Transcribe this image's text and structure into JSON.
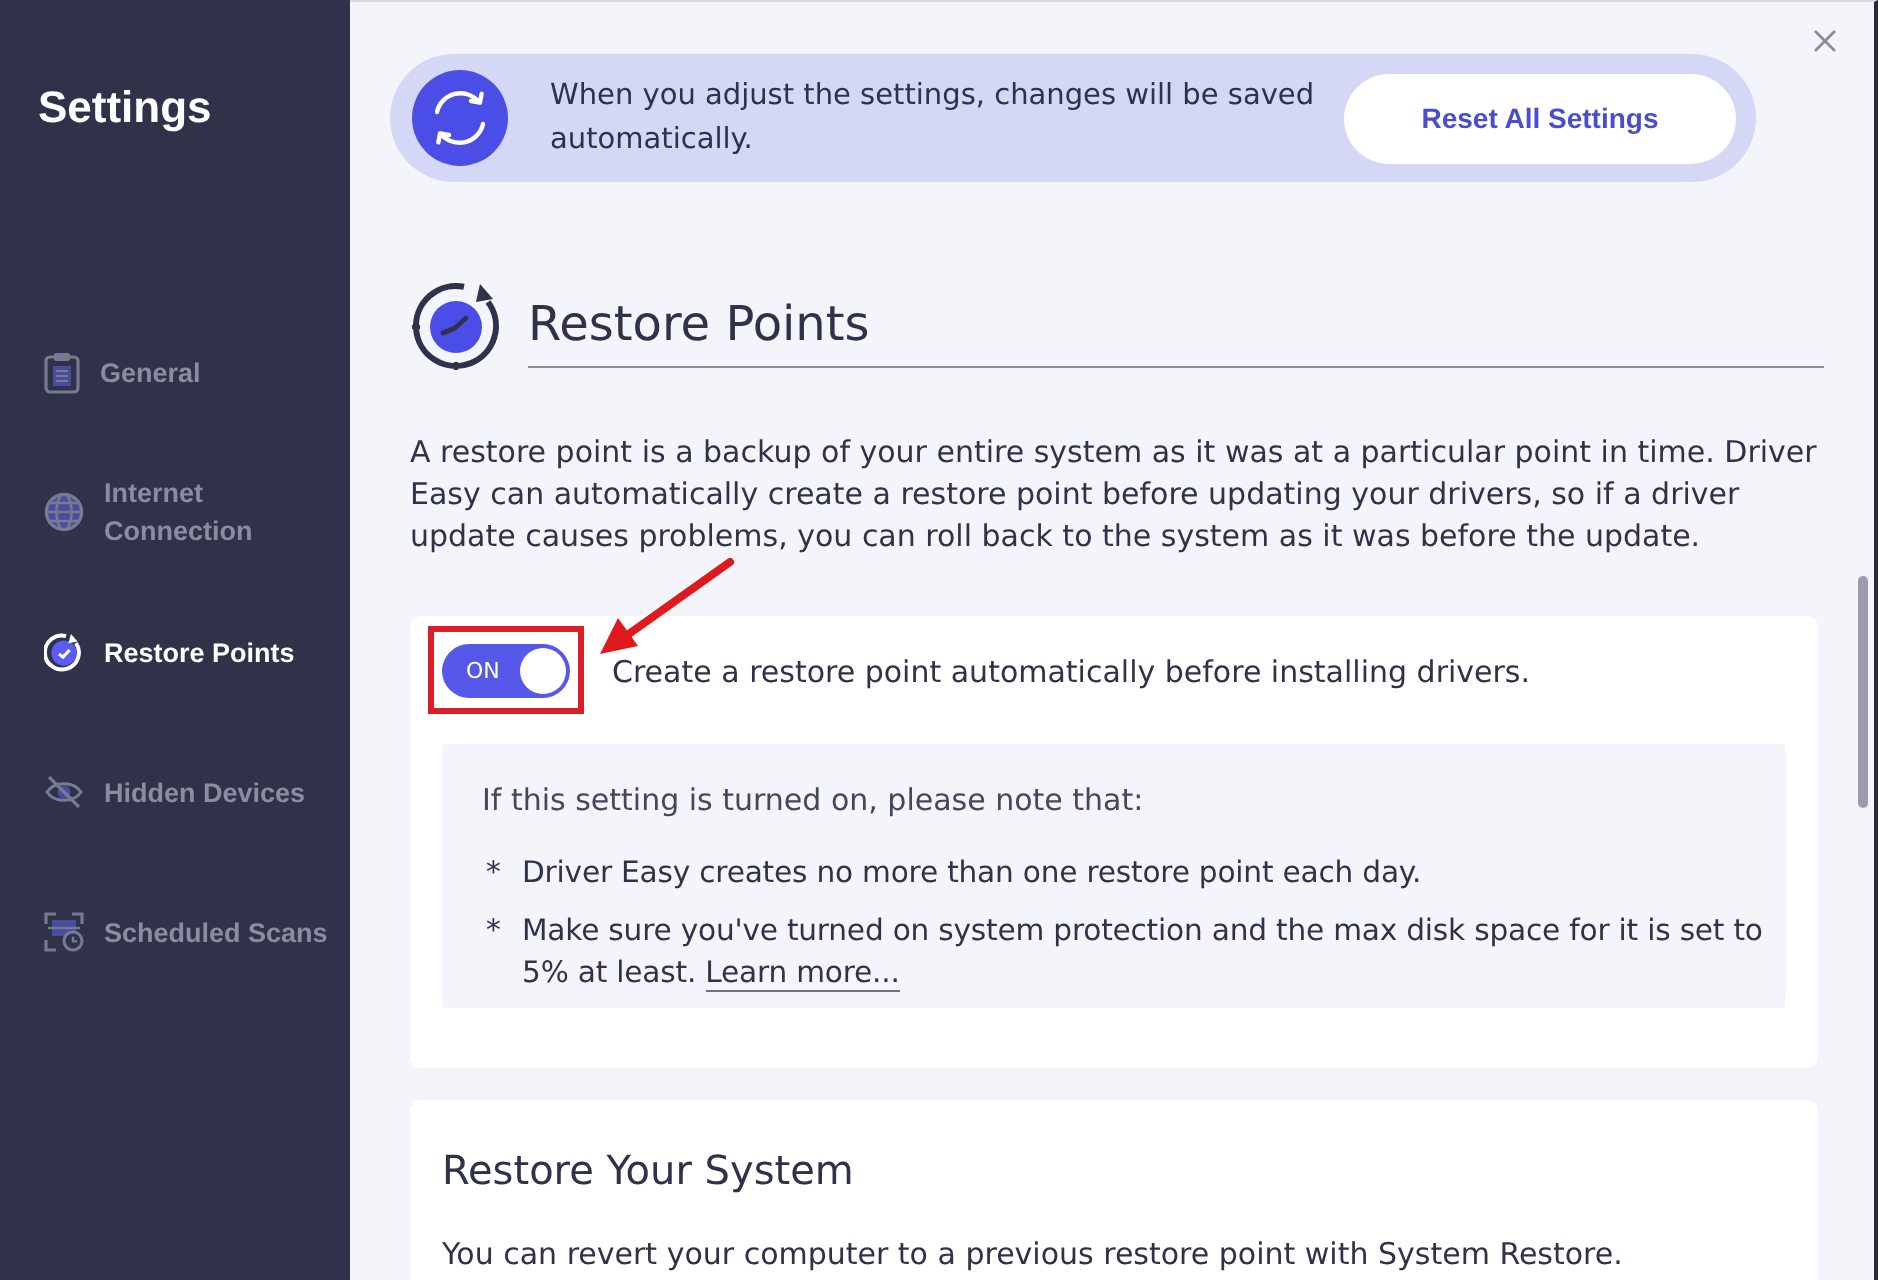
{
  "sidebar": {
    "title": "Settings",
    "items": [
      {
        "label": "General",
        "selected": false
      },
      {
        "label": "Internet Connection",
        "selected": false
      },
      {
        "label": "Restore Points",
        "selected": true
      },
      {
        "label": "Hidden Devices",
        "selected": false
      },
      {
        "label": "Scheduled Scans",
        "selected": false
      }
    ]
  },
  "banner": {
    "message": "When you adjust the settings, changes will be saved automatically.",
    "button": "Reset All Settings"
  },
  "section": {
    "title": "Restore Points",
    "description": "A restore point is a backup of your entire system as it was at a particular point in time. Driver Easy can automatically create a restore point before updating your drivers, so if a driver update causes problems, you can roll back to the system as it was before the update.",
    "setting": {
      "label": "Create a restore point automatically before installing drivers.",
      "on": true,
      "toggle_text": "ON",
      "highlighted": true
    },
    "note": {
      "intro": "If this setting is turned on, please note that:",
      "bullets": [
        {
          "marker": "*",
          "text": "Driver Easy creates no more than one restore point each day."
        },
        {
          "marker": "*",
          "text": "Make sure you've turned on system protection and the max disk space for it is set to 5% at least.",
          "link": "Learn more..."
        }
      ]
    }
  },
  "restore_card": {
    "title": "Restore Your System",
    "text": "You can revert your computer to a previous restore point with System Restore."
  }
}
